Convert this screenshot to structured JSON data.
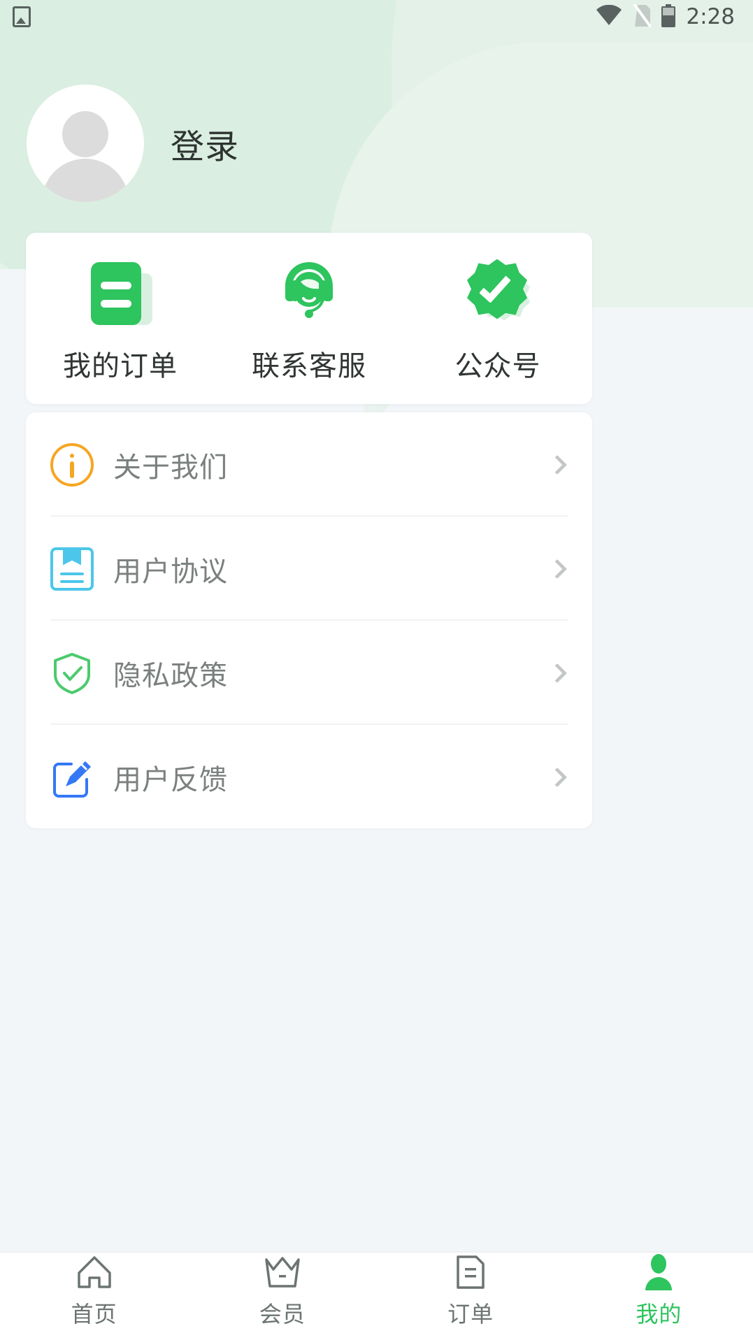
{
  "status_bar": {
    "time": "2:28",
    "icons": [
      "image-icon",
      "wifi-icon",
      "no-sim-icon",
      "battery-icon"
    ]
  },
  "header": {
    "login_label": "登录",
    "avatar_icon": "default-avatar-icon"
  },
  "quick_actions": {
    "items": [
      {
        "label": "我的订单",
        "icon": "order-document-icon"
      },
      {
        "label": "联系客服",
        "icon": "customer-service-headset-icon"
      },
      {
        "label": "公众号",
        "icon": "verified-badge-icon"
      }
    ]
  },
  "menu": {
    "items": [
      {
        "label": "关于我们",
        "icon": "info-circle-icon",
        "icon_color": "#f5a623"
      },
      {
        "label": "用户协议",
        "icon": "agreement-book-icon",
        "icon_color": "#4cc6ea"
      },
      {
        "label": "隐私政策",
        "icon": "shield-check-icon",
        "icon_color": "#4cca6e"
      },
      {
        "label": "用户反馈",
        "icon": "edit-pencil-icon",
        "icon_color": "#3478f6"
      }
    ],
    "chevron_icon": "chevron-right-icon"
  },
  "tabbar": {
    "items": [
      {
        "label": "首页",
        "icon": "home-icon",
        "active": false
      },
      {
        "label": "会员",
        "icon": "crown-icon",
        "active": false
      },
      {
        "label": "订单",
        "icon": "order-list-icon",
        "active": false
      },
      {
        "label": "我的",
        "icon": "person-icon",
        "active": true
      }
    ]
  },
  "colors": {
    "brand_green": "#2ec45e",
    "page_bg": "#f3f6f9",
    "header_green": "#e2f0e6",
    "text_primary": "#2d3330",
    "text_secondary": "#7a807e"
  }
}
